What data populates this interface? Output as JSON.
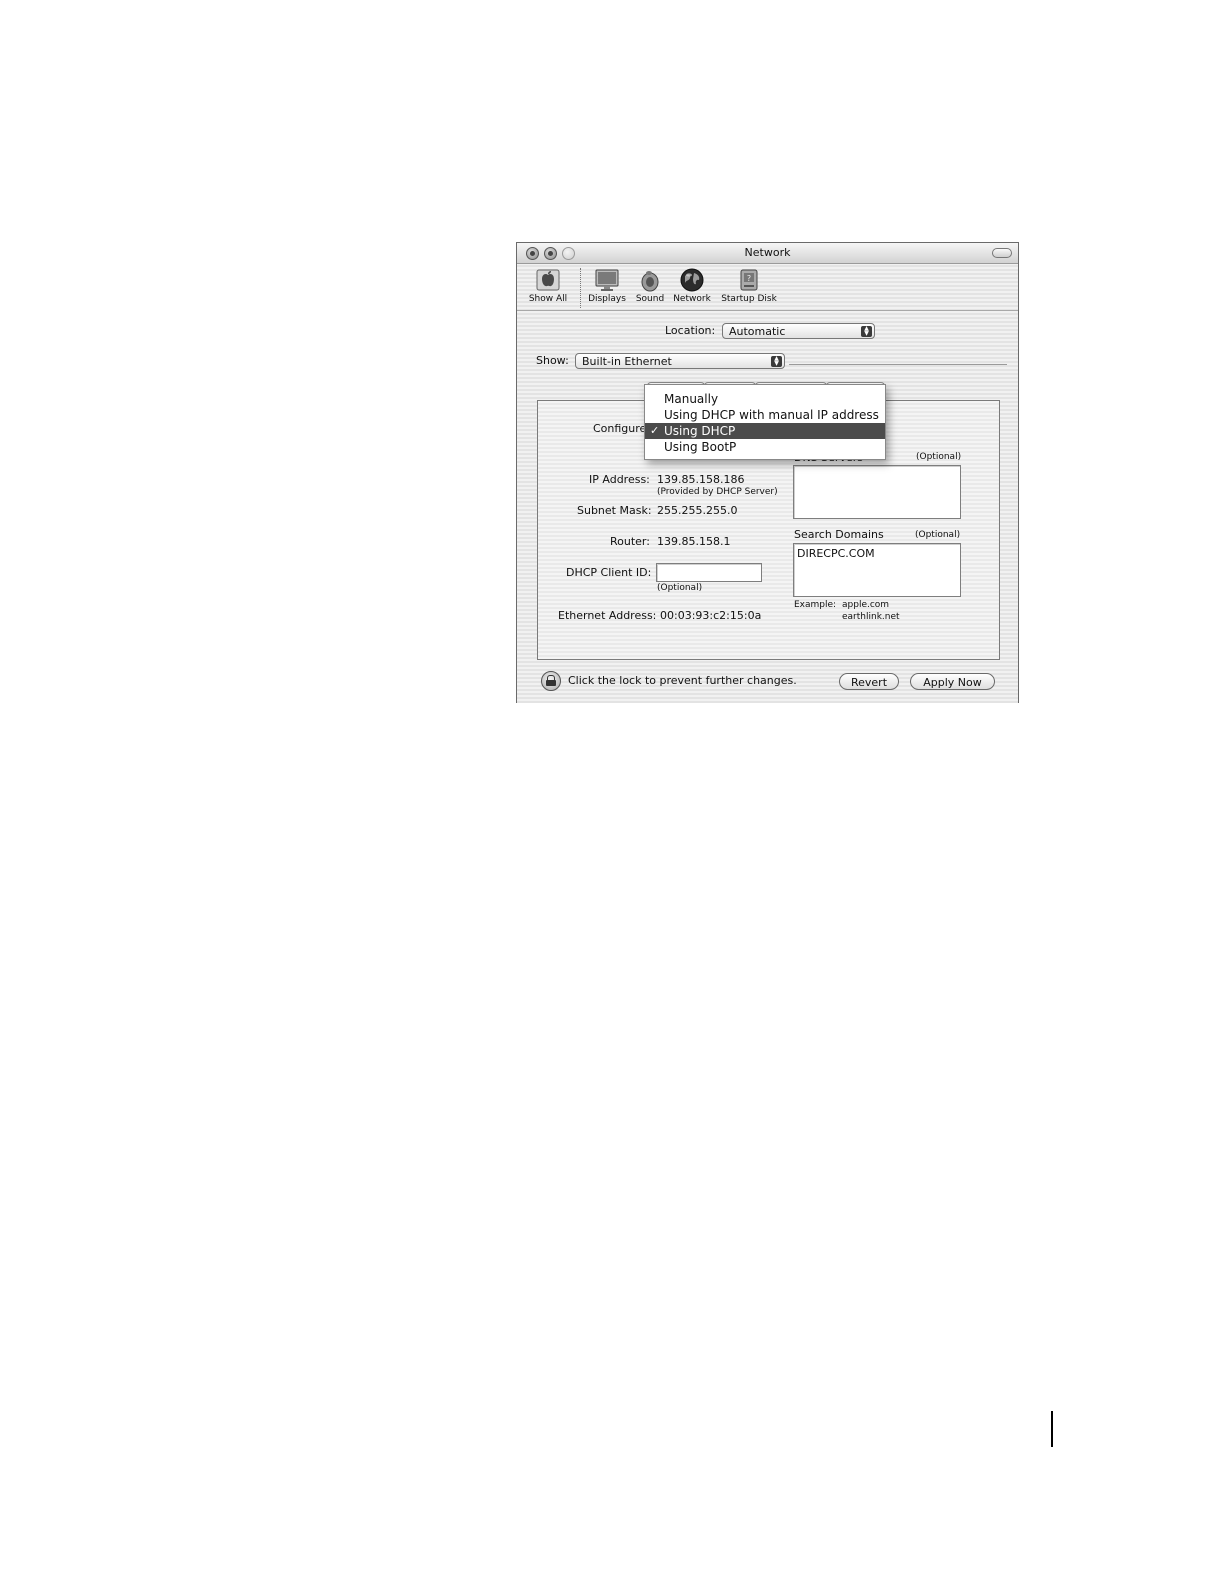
{
  "window": {
    "title": "Network"
  },
  "toolbar": {
    "items": [
      {
        "label": "Show All",
        "icon": "apple-icon"
      },
      {
        "label": "Displays",
        "icon": "displays-icon"
      },
      {
        "label": "Sound",
        "icon": "sound-icon"
      },
      {
        "label": "Network",
        "icon": "network-globe-icon"
      },
      {
        "label": "Startup Disk",
        "icon": "startup-disk-icon"
      }
    ]
  },
  "location": {
    "label": "Location:",
    "value": "Automatic"
  },
  "show": {
    "label": "Show:",
    "value": "Built-in Ethernet"
  },
  "configure": {
    "label": "Configure",
    "options": [
      "Manually",
      "Using DHCP with manual IP address",
      "Using DHCP",
      "Using BootP"
    ],
    "selected": "Using DHCP",
    "check": "✓"
  },
  "tcpip": {
    "ip_label": "IP Address:",
    "ip_value": "139.85.158.186",
    "ip_note": "(Provided by DHCP Server)",
    "subnet_label": "Subnet Mask:",
    "subnet_value": "255.255.255.0",
    "router_label": "Router:",
    "router_value": "139.85.158.1",
    "dhcp_client_label": "DHCP Client ID:",
    "dhcp_client_value": "",
    "dhcp_client_note": "(Optional)",
    "ethernet_label": "Ethernet Address:",
    "ethernet_value": "00:03:93:c2:15:0a"
  },
  "dns": {
    "label": "DNS Servers",
    "optional": "(Optional)",
    "value": ""
  },
  "search_domains": {
    "label": "Search Domains",
    "optional": "(Optional)",
    "value": "DIRECPC.COM",
    "example_label": "Example:",
    "example_1": "apple.com",
    "example_2": "earthlink.net"
  },
  "footer": {
    "lock_text": "Click the lock to prevent further changes.",
    "revert_label": "Revert",
    "apply_label": "Apply Now"
  },
  "colors": {
    "selection": "#4b4b4b",
    "window_stripe": "#e3e3e3"
  }
}
